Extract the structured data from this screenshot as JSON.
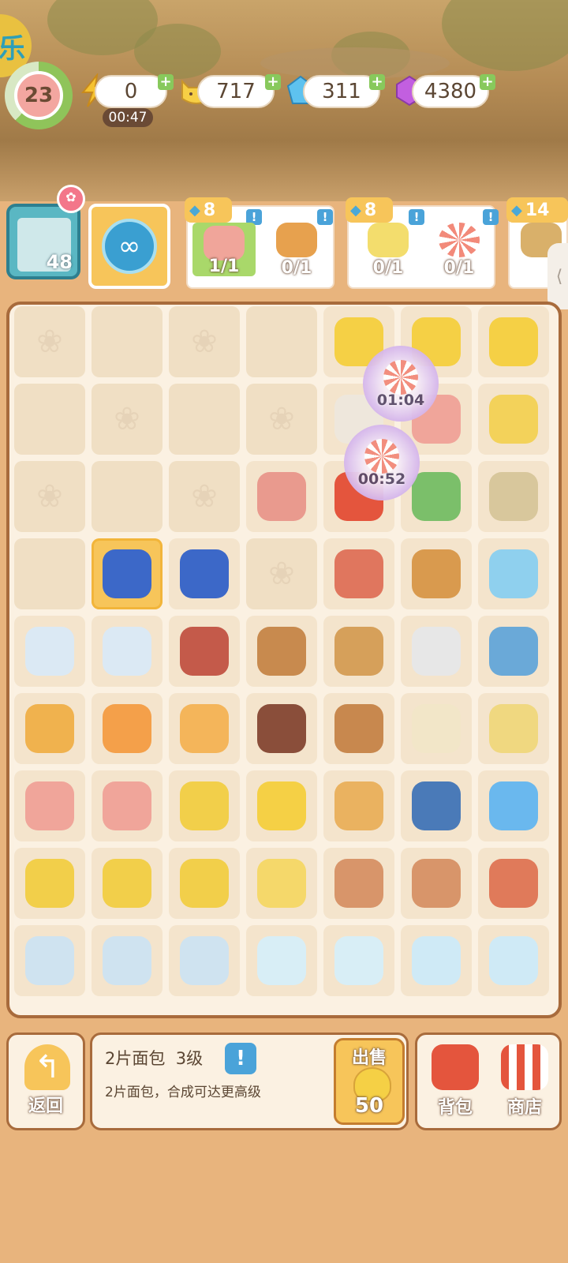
{
  "player": {
    "level": "23"
  },
  "resources": {
    "energy": {
      "value": "0",
      "timer": "00:47",
      "icon": "lightning-icon"
    },
    "coins": {
      "value": "717",
      "icon": "cat-coin-icon"
    },
    "gems": {
      "value": "311",
      "icon": "blue-gem-icon"
    },
    "crystals": {
      "value": "4380",
      "icon": "purple-crystal-icon"
    }
  },
  "orders": {
    "notebook_count": "48",
    "cards": [
      {
        "reward": "8",
        "items": [
          {
            "name": "candy-roll",
            "count": "1/1",
            "done": true
          },
          {
            "name": "heart-cookies",
            "count": "0/1",
            "done": false
          }
        ]
      },
      {
        "reward": "8",
        "items": [
          {
            "name": "cheese-jar",
            "count": "0/1",
            "done": false
          },
          {
            "name": "lollipop",
            "count": "0/1",
            "done": false
          }
        ]
      },
      {
        "reward": "14",
        "items": [
          {
            "name": "sandwich",
            "count": "",
            "done": false
          }
        ]
      }
    ]
  },
  "board": {
    "timers": [
      "01:04",
      "00:52"
    ]
  },
  "selected_item": {
    "title": "2片面包  3级",
    "description": "2片面包，合成可达更高级",
    "sell_label": "出售",
    "sell_price": "50"
  },
  "buttons": {
    "back": "返回",
    "backpack": "背包",
    "shop": "商店"
  },
  "colors": {
    "accent_yellow": "#f7c55a",
    "board_border": "#a86b3c",
    "info_blue": "#4aa3d9",
    "check_green": "#88c95c"
  }
}
